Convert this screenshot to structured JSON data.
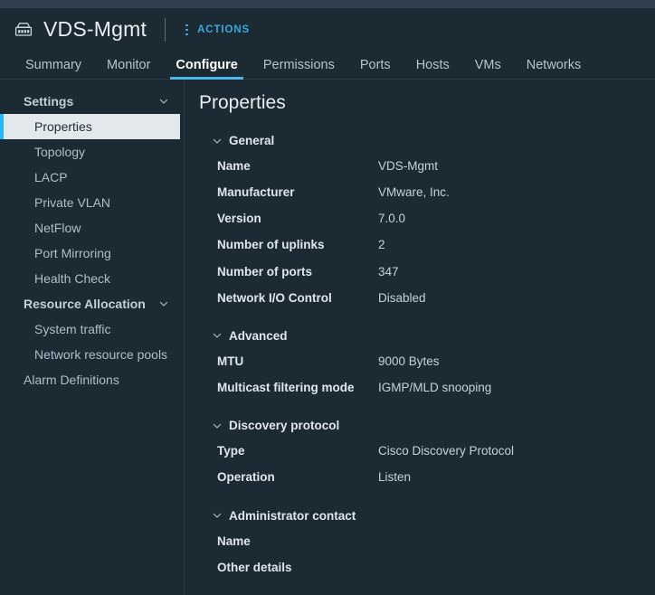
{
  "header": {
    "object_icon": "distributed-switch-icon",
    "title": "VDS-Mgmt",
    "actions_label": "ACTIONS",
    "actions_icon": "kebab-menu-icon"
  },
  "tabs": [
    {
      "label": "Summary",
      "active": false
    },
    {
      "label": "Monitor",
      "active": false
    },
    {
      "label": "Configure",
      "active": true
    },
    {
      "label": "Permissions",
      "active": false
    },
    {
      "label": "Ports",
      "active": false
    },
    {
      "label": "Hosts",
      "active": false
    },
    {
      "label": "VMs",
      "active": false
    },
    {
      "label": "Networks",
      "active": false
    }
  ],
  "sidebar": {
    "groups": [
      {
        "label": "Settings",
        "chevron": "chevron-down-icon",
        "items": [
          {
            "label": "Properties",
            "selected": true
          },
          {
            "label": "Topology",
            "selected": false
          },
          {
            "label": "LACP",
            "selected": false
          },
          {
            "label": "Private VLAN",
            "selected": false
          },
          {
            "label": "NetFlow",
            "selected": false
          },
          {
            "label": "Port Mirroring",
            "selected": false
          },
          {
            "label": "Health Check",
            "selected": false
          }
        ]
      },
      {
        "label": "Resource Allocation",
        "chevron": "chevron-down-icon",
        "items": [
          {
            "label": "System traffic",
            "selected": false
          },
          {
            "label": "Network resource pools",
            "selected": false
          }
        ]
      }
    ],
    "root_items": [
      {
        "label": "Alarm Definitions",
        "selected": false
      }
    ]
  },
  "main": {
    "page_title": "Properties",
    "sections": [
      {
        "title": "General",
        "chevron": "chevron-down-icon",
        "rows": [
          {
            "label": "Name",
            "value": "VDS-Mgmt"
          },
          {
            "label": "Manufacturer",
            "value": "VMware, Inc."
          },
          {
            "label": "Version",
            "value": "7.0.0"
          },
          {
            "label": "Number of uplinks",
            "value": "2"
          },
          {
            "label": "Number of ports",
            "value": "347"
          },
          {
            "label": "Network I/O Control",
            "value": "Disabled"
          }
        ]
      },
      {
        "title": "Advanced",
        "chevron": "chevron-down-icon",
        "rows": [
          {
            "label": "MTU",
            "value": "9000 Bytes"
          },
          {
            "label": "Multicast filtering mode",
            "value": "IGMP/MLD snooping"
          }
        ]
      },
      {
        "title": "Discovery protocol",
        "chevron": "chevron-down-icon",
        "rows": [
          {
            "label": "Type",
            "value": "Cisco Discovery Protocol"
          },
          {
            "label": "Operation",
            "value": "Listen"
          }
        ]
      },
      {
        "title": "Administrator contact",
        "chevron": "chevron-down-icon",
        "rows": [
          {
            "label": "Name",
            "value": ""
          },
          {
            "label": "Other details",
            "value": ""
          }
        ]
      }
    ]
  },
  "colors": {
    "background": "#1b2a33",
    "top_strip": "#2e4050",
    "accent_cyan": "#4db5e8",
    "actions_link": "#39a9dd",
    "selected_item_bg": "#e2e8eb",
    "selected_item_bar": "#29b6f6",
    "text_primary": "#e8eef2",
    "text_secondary": "#c5d2db"
  }
}
